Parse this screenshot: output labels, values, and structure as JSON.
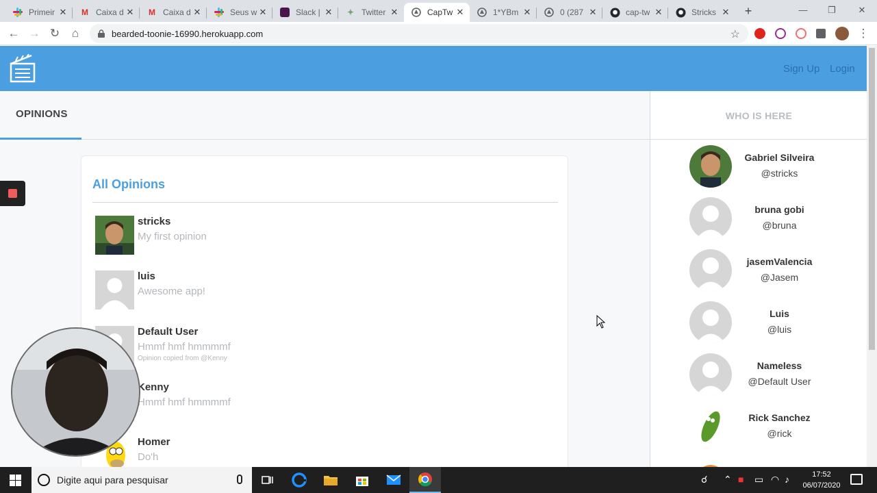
{
  "browser": {
    "tabs": [
      {
        "title": "Primeir",
        "icon": "slack-icon"
      },
      {
        "title": "Caixa d",
        "icon": "gmail-icon"
      },
      {
        "title": "Caixa d",
        "icon": "gmail-icon"
      },
      {
        "title": "Seus w",
        "icon": "slack-icon"
      },
      {
        "title": "Slack |",
        "icon": "slack-icon"
      },
      {
        "title": "Twitter",
        "icon": "twitter-icon"
      },
      {
        "title": "CapTw",
        "icon": "globe-icon"
      },
      {
        "title": "1*YBm",
        "icon": "globe-icon"
      },
      {
        "title": "0 (287",
        "icon": "globe-icon"
      },
      {
        "title": "cap-tw",
        "icon": "github-icon"
      },
      {
        "title": "Stricks",
        "icon": "github-icon"
      }
    ],
    "url": "bearded-toonie-16990.herokuapp.com"
  },
  "navbar": {
    "signup": "Sign Up",
    "login": "Login"
  },
  "main": {
    "tab_label": "OPINIONS",
    "card_title": "All Opinions",
    "opinions": [
      {
        "author": "stricks",
        "text": "My first opinion",
        "note": ""
      },
      {
        "author": "luis",
        "text": "Awesome app!",
        "note": ""
      },
      {
        "author": "Default User",
        "text": "Hmmf hmf hmmmmf",
        "note": "Opinion copied from @Kenny"
      },
      {
        "author": "Kenny",
        "text": "Hmmf hmf hmmmmf",
        "note": ""
      },
      {
        "author": "Homer",
        "text": "Do'h",
        "note": ""
      }
    ]
  },
  "sidebar": {
    "title": "WHO IS HERE",
    "users": [
      {
        "name": "Gabriel Silveira",
        "handle": "@stricks"
      },
      {
        "name": "bruna gobi",
        "handle": "@bruna"
      },
      {
        "name": "jasemValencia",
        "handle": "@Jasem"
      },
      {
        "name": "Luis",
        "handle": "@luis"
      },
      {
        "name": "Nameless",
        "handle": "@Default User"
      },
      {
        "name": "Rick Sanchez",
        "handle": "@rick"
      }
    ]
  },
  "taskbar": {
    "search_placeholder": "Digite aqui para pesquisar",
    "time": "17:52",
    "date": "06/07/2020"
  },
  "colors": {
    "accent": "#4b9fe1",
    "nav_link": "#2b6fb0",
    "muted": "#b4b8bc"
  }
}
